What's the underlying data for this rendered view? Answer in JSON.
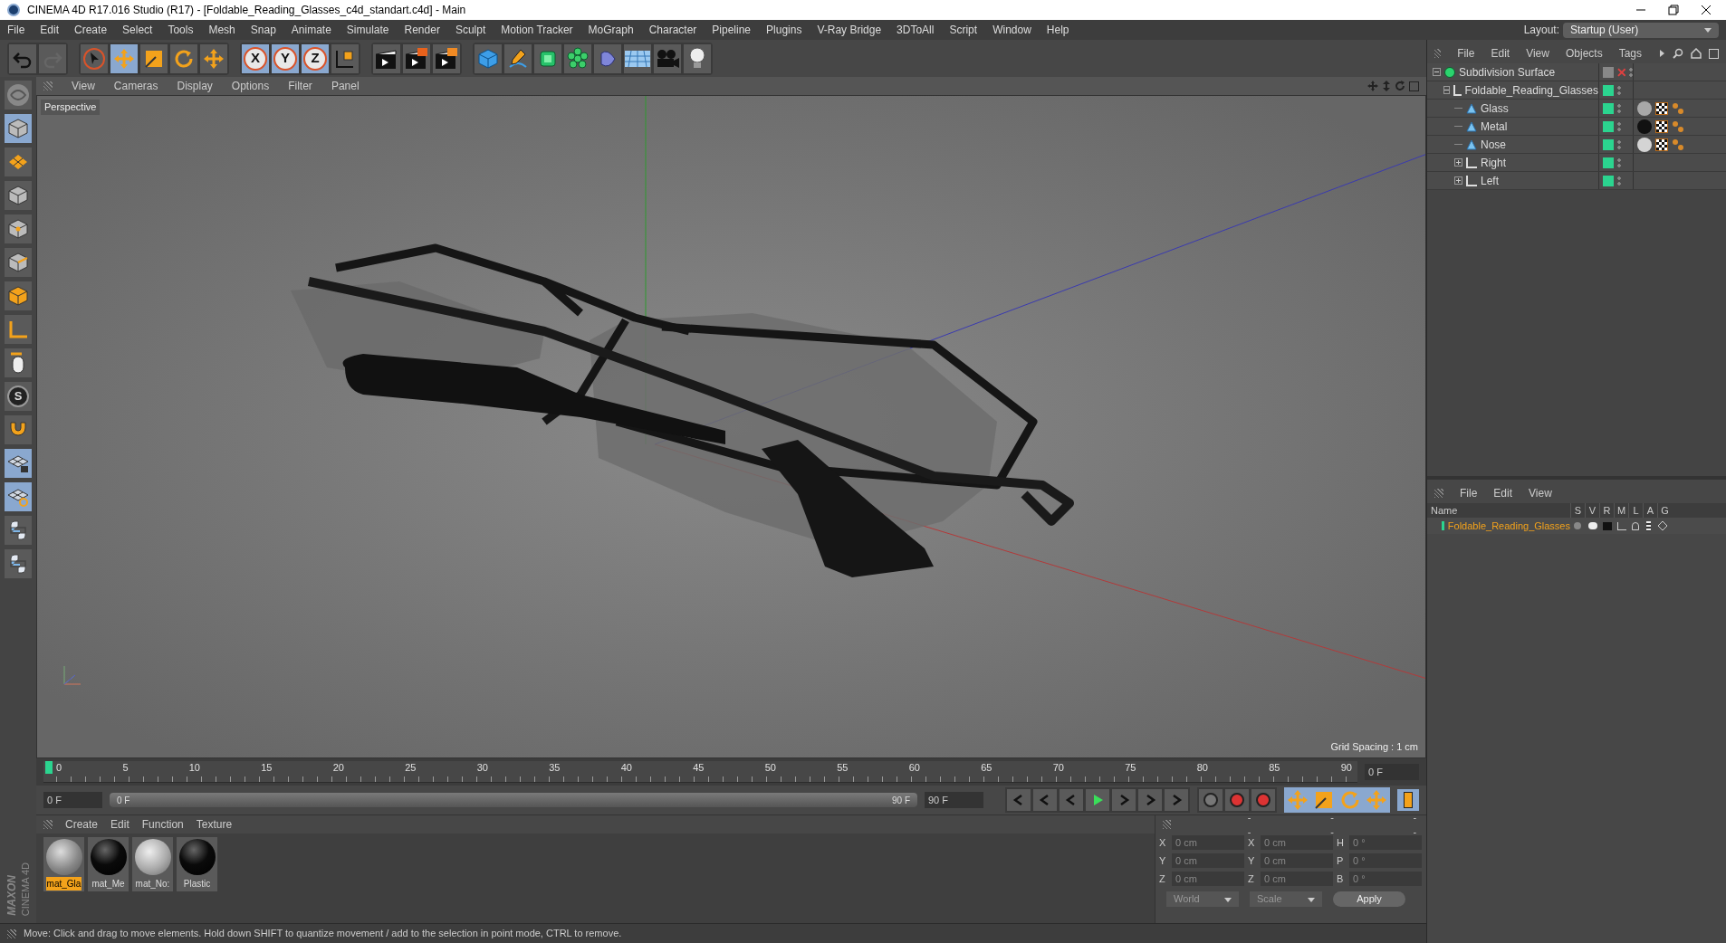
{
  "window": {
    "title": "CINEMA 4D R17.016 Studio (R17) - [Foldable_Reading_Glasses_c4d_standart.c4d] - Main"
  },
  "menu": [
    "File",
    "Edit",
    "Create",
    "Select",
    "Tools",
    "Mesh",
    "Snap",
    "Animate",
    "Simulate",
    "Render",
    "Sculpt",
    "Motion Tracker",
    "MoGraph",
    "Character",
    "Pipeline",
    "Plugins",
    "V-Ray Bridge",
    "3DToAll",
    "Script",
    "Window",
    "Help"
  ],
  "layout": {
    "label": "Layout:",
    "value": "Startup (User)"
  },
  "toolbar": [
    {
      "kind": "undo",
      "active": false
    },
    {
      "kind": "redo",
      "active": false
    },
    {
      "kind": "select",
      "active": false
    },
    {
      "kind": "move",
      "active": true
    },
    {
      "kind": "scale",
      "active": false
    },
    {
      "kind": "rotate",
      "active": false
    },
    {
      "kind": "transform",
      "active": false
    },
    {
      "kind": "axis",
      "label": "X",
      "active": true
    },
    {
      "kind": "axis",
      "label": "Y",
      "active": true
    },
    {
      "kind": "axis",
      "label": "Z",
      "active": true
    },
    {
      "kind": "coords",
      "active": false
    },
    {
      "kind": "render-view",
      "active": false
    },
    {
      "kind": "render-picture",
      "active": false
    },
    {
      "kind": "render-settings",
      "active": false
    },
    {
      "kind": "cube",
      "active": false
    },
    {
      "kind": "pen",
      "active": false
    },
    {
      "kind": "subdivision",
      "active": false
    },
    {
      "kind": "cloner",
      "active": false
    },
    {
      "kind": "deformer",
      "active": false
    },
    {
      "kind": "floor",
      "active": false
    },
    {
      "kind": "camera",
      "active": false
    },
    {
      "kind": "light",
      "active": false
    }
  ],
  "left_tools": [
    {
      "kind": "model",
      "active": false
    },
    {
      "kind": "object",
      "active": true
    },
    {
      "kind": "texture",
      "active": false
    },
    {
      "kind": "workplane",
      "active": false
    },
    {
      "kind": "points",
      "active": false
    },
    {
      "kind": "edges",
      "active": false
    },
    {
      "kind": "polygons",
      "active": false
    },
    {
      "kind": "axis",
      "active": false
    },
    {
      "kind": "tweak",
      "active": false
    },
    {
      "kind": "solo",
      "label": "S",
      "active": false
    },
    {
      "kind": "magnet",
      "active": false
    },
    {
      "kind": "snap-grid",
      "active": true
    },
    {
      "kind": "snap-lock",
      "active": true
    },
    {
      "kind": "python",
      "active": false
    },
    {
      "kind": "python",
      "active": false
    }
  ],
  "brand": {
    "line_1": "MAXON",
    "line_2": "CINEMA 4D"
  },
  "viewport": {
    "menu": [
      "View",
      "Cameras",
      "Display",
      "Options",
      "Filter",
      "Panel"
    ],
    "camera": "Perspective",
    "grid_spacing": "Grid Spacing : 1 cm"
  },
  "timeline": {
    "ticks": [
      "0",
      "5",
      "10",
      "15",
      "20",
      "25",
      "30",
      "35",
      "40",
      "45",
      "50",
      "55",
      "60",
      "65",
      "70",
      "75",
      "80",
      "85",
      "90"
    ],
    "current_frame": "0 F",
    "start": "0 F",
    "range": {
      "start": "0 F",
      "end": "90 F",
      "level": 1
    },
    "end": "90 F"
  },
  "materials": {
    "menu": [
      "Create",
      "Edit",
      "Function",
      "Texture"
    ],
    "items": [
      {
        "name": "mat_Gla",
        "kind": "glass",
        "selected": true
      },
      {
        "name": "mat_Me",
        "kind": "black",
        "selected": false
      },
      {
        "name": "mat_No:",
        "kind": "white",
        "selected": false
      },
      {
        "name": "Plastic",
        "kind": "black",
        "selected": false
      }
    ]
  },
  "coordinates": {
    "headers": [
      "--",
      "--",
      "--"
    ],
    "rows": [
      {
        "axis": "X",
        "position": "0 cm",
        "axis_2": "X",
        "size": "0 cm",
        "angle_axis": "H",
        "rotation": "0 °"
      },
      {
        "axis": "Y",
        "position": "0 cm",
        "axis_2": "Y",
        "size": "0 cm",
        "angle_axis": "P",
        "rotation": "0 °"
      },
      {
        "axis": "Z",
        "position": "0 cm",
        "axis_2": "Z",
        "size": "0 cm",
        "angle_axis": "B",
        "rotation": "0 °"
      }
    ],
    "space": "World",
    "mode": "Scale",
    "apply": "Apply"
  },
  "status_bar": "Move: Click and drag to move elements. Hold down SHIFT to quantize movement / add to the selection in point mode, CTRL to remove.",
  "object_manager": {
    "menu": [
      "File",
      "Edit",
      "View",
      "Objects",
      "Tags"
    ],
    "objects": [
      {
        "name": "Subdivision Surface",
        "kind": "subdivision",
        "expanded": true,
        "enabled": false,
        "children": [
          {
            "name": "Foldable_Reading_Glasses",
            "kind": "null",
            "expanded": true,
            "children": [
              {
                "name": "Glass",
                "kind": "polygon",
                "color": "#a8a8a8"
              },
              {
                "name": "Metal",
                "kind": "polygon",
                "color": "#111111"
              },
              {
                "name": "Nose",
                "kind": "polygon",
                "color": "#d4d4d4"
              },
              {
                "name": "Right",
                "kind": "null",
                "expanded": false
              },
              {
                "name": "Left",
                "kind": "null",
                "expanded": false
              }
            ]
          }
        ]
      }
    ]
  },
  "layer_manager": {
    "menu": [
      "File",
      "Edit",
      "View"
    ],
    "columns": [
      "Name",
      "S",
      "V",
      "R",
      "M",
      "L",
      "A",
      "G"
    ],
    "rows": [
      {
        "name": "Foldable_Reading_Glasses",
        "color": "#2bd48f"
      }
    ]
  }
}
